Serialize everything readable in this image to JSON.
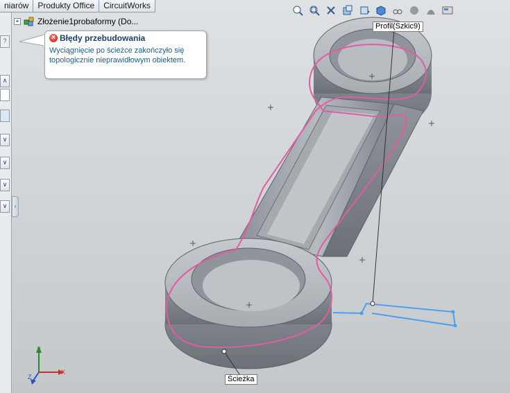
{
  "tabs": [
    "niarów",
    "Produkty Office",
    "CircuitWorks"
  ],
  "tree": {
    "root_label": "Złożenie1probaformy  (Do..."
  },
  "tooltip": {
    "title": "Błędy przebudowania",
    "message": "Wyciągnięcie po ścieżce zakończyło się topologicznie nieprawidłowym obiektem."
  },
  "callouts": {
    "profile": "Profil(Szkic9)",
    "path": "Ścieżka"
  },
  "view_toolbar": [
    "zoom-to-fit-icon",
    "zoom-to-area-icon",
    "previous-view-icon",
    "section-view-icon",
    "view-orientation-icon",
    "display-style-icon",
    "hide-show-items-icon",
    "edit-appearance-icon",
    "apply-scene-icon",
    "view-settings-icon"
  ],
  "triad_axes": {
    "x": "X",
    "y": "Y",
    "z": "Z"
  },
  "colors": {
    "path_sketch": "#e35aa6",
    "profile_sketch": "#4aa0f0",
    "model_gray": "#9ea3a9"
  }
}
